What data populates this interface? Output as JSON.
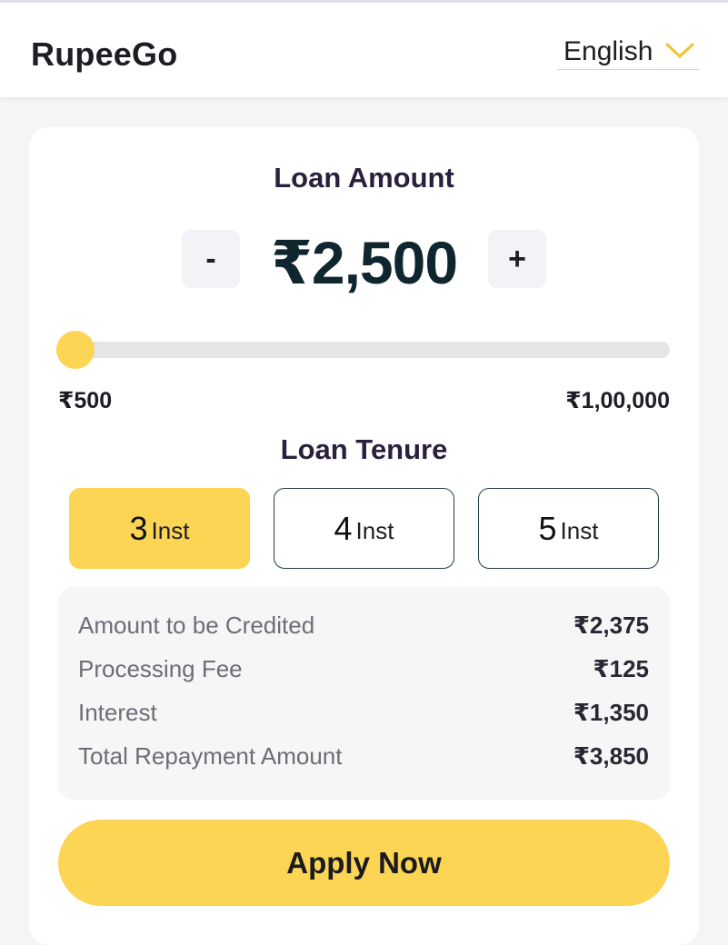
{
  "header": {
    "brand": "RupeeGo",
    "language": "English",
    "language_icon": "chevron-down-icon",
    "accent_color": "#fbd553"
  },
  "loan_amount": {
    "title": "Loan Amount",
    "decrement_label": "-",
    "increment_label": "+",
    "value": "₹2,500",
    "min_label": "₹500",
    "max_label": "₹1,00,000",
    "slider_fraction": 0.0
  },
  "tenure": {
    "title": "Loan Tenure",
    "options": [
      {
        "count": "3",
        "unit": "Inst",
        "selected": true
      },
      {
        "count": "4",
        "unit": "Inst",
        "selected": false
      },
      {
        "count": "5",
        "unit": "Inst",
        "selected": false
      }
    ]
  },
  "summary": {
    "rows": [
      {
        "label": "Amount to be Credited",
        "value": "₹2,375"
      },
      {
        "label": "Processing Fee",
        "value": "₹125"
      },
      {
        "label": "Interest",
        "value": "₹1,350"
      },
      {
        "label": "Total Repayment Amount",
        "value": "₹3,850"
      }
    ]
  },
  "cta": {
    "apply_label": "Apply Now"
  }
}
